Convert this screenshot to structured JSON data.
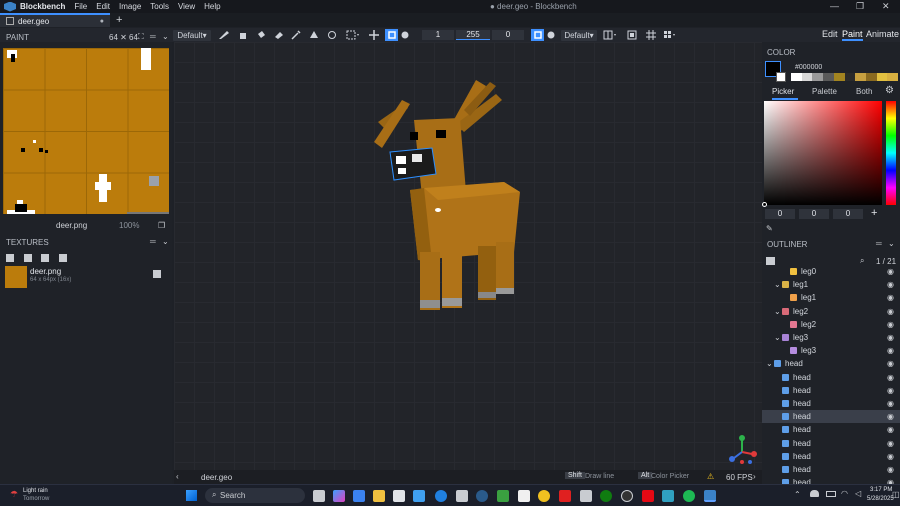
{
  "titlebar": {
    "app": "Blockbench",
    "menus": [
      "File",
      "Edit",
      "Image",
      "Tools",
      "View",
      "Help"
    ],
    "window_title": "● deer.geo - Blockbench",
    "controls": [
      "—",
      "❐",
      "✕"
    ]
  },
  "tabs": [
    {
      "label": "deer.geo",
      "close": "●"
    }
  ],
  "newtab": "+",
  "toolbar": {
    "brush_mode": "Default",
    "num1": "1",
    "num2": "255",
    "num3": "0",
    "blend": "Default"
  },
  "modes": [
    "Edit",
    "Paint",
    "Animate"
  ],
  "paint": {
    "header": "PAINT",
    "size": "64 ✕ 64",
    "file": "deer.png",
    "zoom": "100%"
  },
  "textures": {
    "header": "TEXTURES",
    "name": "deer.png",
    "info": "64 x 64px (16x)"
  },
  "color": {
    "header": "COLOR",
    "hex": "#000000",
    "tabs": [
      "Picker",
      "Palette",
      "Both"
    ],
    "r": "0",
    "g": "0",
    "b": "0",
    "plus": "+"
  },
  "outliner": {
    "header": "OUTLINER",
    "count": "1 / 21",
    "rows": [
      {
        "label": "leg0",
        "indent": 2,
        "type": "cube"
      },
      {
        "label": "leg1",
        "indent": 1,
        "type": "folder",
        "color": "#d9b246"
      },
      {
        "label": "leg1",
        "indent": 2,
        "type": "cube",
        "color": "#f0a14a"
      },
      {
        "label": "leg2",
        "indent": 1,
        "type": "folder",
        "color": "#d96a78"
      },
      {
        "label": "leg2",
        "indent": 2,
        "type": "cube",
        "color": "#e37791"
      },
      {
        "label": "leg3",
        "indent": 1,
        "type": "folder",
        "color": "#a883d6"
      },
      {
        "label": "leg3",
        "indent": 2,
        "type": "cube",
        "color": "#b58de0"
      },
      {
        "label": "head",
        "indent": 0,
        "type": "folder",
        "color": "#5e9ee8"
      },
      {
        "label": "head",
        "indent": 1,
        "type": "cube",
        "color": "#5e9ee8"
      },
      {
        "label": "head",
        "indent": 1,
        "type": "cube",
        "color": "#5e9ee8"
      },
      {
        "label": "head",
        "indent": 1,
        "type": "cube",
        "color": "#5e9ee8"
      },
      {
        "label": "head",
        "indent": 1,
        "type": "cube",
        "color": "#5e9ee8",
        "selected": true
      },
      {
        "label": "head",
        "indent": 1,
        "type": "cube",
        "color": "#5e9ee8"
      },
      {
        "label": "head",
        "indent": 1,
        "type": "cube",
        "color": "#5e9ee8"
      },
      {
        "label": "head",
        "indent": 1,
        "type": "cube",
        "color": "#5e9ee8"
      },
      {
        "label": "head",
        "indent": 1,
        "type": "cube",
        "color": "#5e9ee8"
      },
      {
        "label": "head",
        "indent": 1,
        "type": "cube",
        "color": "#5e9ee8"
      }
    ]
  },
  "viewport": {
    "file": "deer.geo",
    "shift_key": "Shift",
    "shift_action": "Draw line",
    "alt_key": "Alt",
    "alt_action": "Color Picker",
    "fps": "60 FPS"
  },
  "taskbar": {
    "weather": "Light rain",
    "weather_sub": "Tomorrow",
    "search": "Search",
    "time": "3:17 PM",
    "date": "5/28/2025"
  }
}
